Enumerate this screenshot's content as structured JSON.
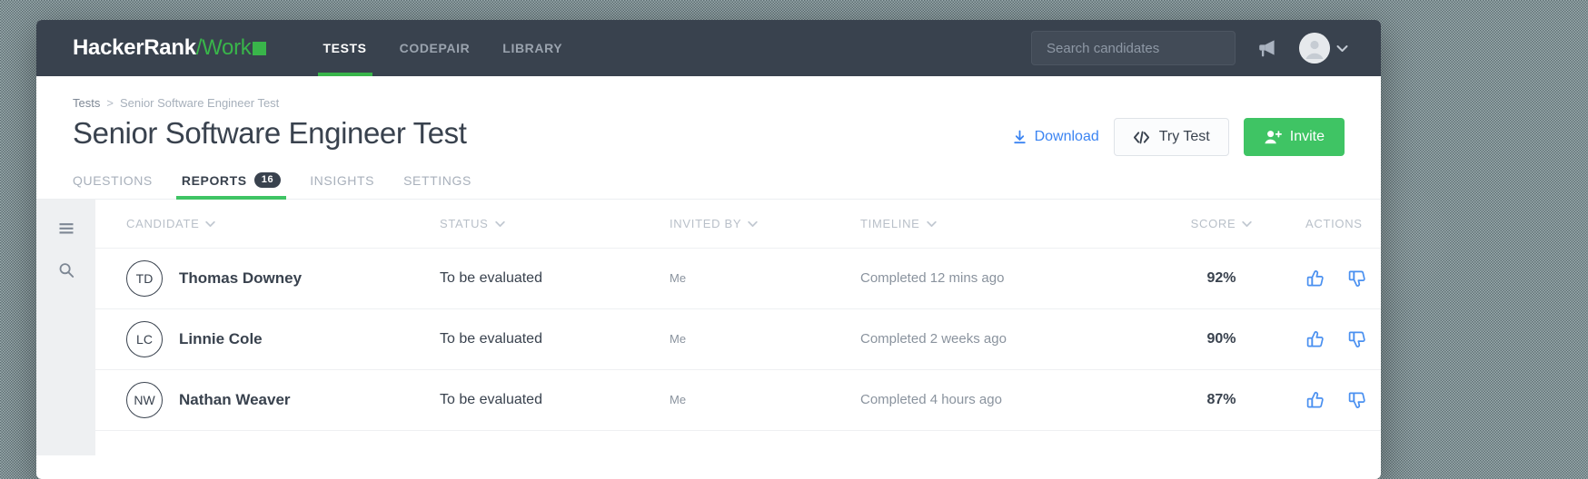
{
  "topnav": {
    "brand": {
      "primary": "HackerRank",
      "secondary": "/Work",
      "square_color": "#39b54a"
    },
    "tabs": [
      {
        "label": "TESTS",
        "active": true
      },
      {
        "label": "CODEPAIR",
        "active": false
      },
      {
        "label": "LIBRARY",
        "active": false
      }
    ],
    "search": {
      "value": "",
      "placeholder": "Search candidates"
    },
    "megaphone_icon": "megaphone-icon",
    "avatar_icon": "avatar-icon",
    "chevron_icon": "chevron-down-icon",
    "background_color": "#39424e"
  },
  "breadcrumb": {
    "root": "Tests",
    "separator": ">",
    "current": "Senior Software Engineer Test"
  },
  "page": {
    "title": "Senior Software Engineer Test"
  },
  "head_actions": {
    "download_label": "Download",
    "download_color": "#3b84f2",
    "try_test_label": "Try Test",
    "invite_label": "Invite",
    "invite_color": "#3fc464"
  },
  "section_tabs": [
    {
      "label": "QUESTIONS",
      "badge": "",
      "active": false
    },
    {
      "label": "REPORTS",
      "badge": "16",
      "active": true
    },
    {
      "label": "INSIGHTS",
      "badge": "",
      "active": false
    },
    {
      "label": "SETTINGS",
      "badge": "",
      "active": false
    }
  ],
  "sidebar": {
    "items": [
      {
        "icon": "hamburger-menu-icon"
      },
      {
        "icon": "search-icon"
      }
    ]
  },
  "table": {
    "columns": [
      {
        "label": "CANDIDATE",
        "sortable": true
      },
      {
        "label": "STATUS",
        "sortable": true
      },
      {
        "label": "INVITED BY",
        "sortable": true
      },
      {
        "label": "TIMELINE",
        "sortable": true
      },
      {
        "label": "SCORE",
        "sortable": true
      },
      {
        "label": "ACTIONS",
        "sortable": false
      }
    ],
    "rows": [
      {
        "initials": "TD",
        "candidate": "Thomas Downey",
        "status": "To be evaluated",
        "invited_by": "Me",
        "timeline": "Completed 12 mins ago",
        "score": "92%"
      },
      {
        "initials": "LC",
        "candidate": "Linnie Cole",
        "status": "To be evaluated",
        "invited_by": "Me",
        "timeline": "Completed 2 weeks ago",
        "score": "90%"
      },
      {
        "initials": "NW",
        "candidate": "Nathan Weaver",
        "status": "To be evaluated",
        "invited_by": "Me",
        "timeline": "Completed 4 hours ago",
        "score": "87%"
      }
    ],
    "row_action_icons": [
      "thumbs-up-icon",
      "thumbs-down-icon",
      "more-options-icon"
    ],
    "action_icon_color": "#4a90f0"
  }
}
